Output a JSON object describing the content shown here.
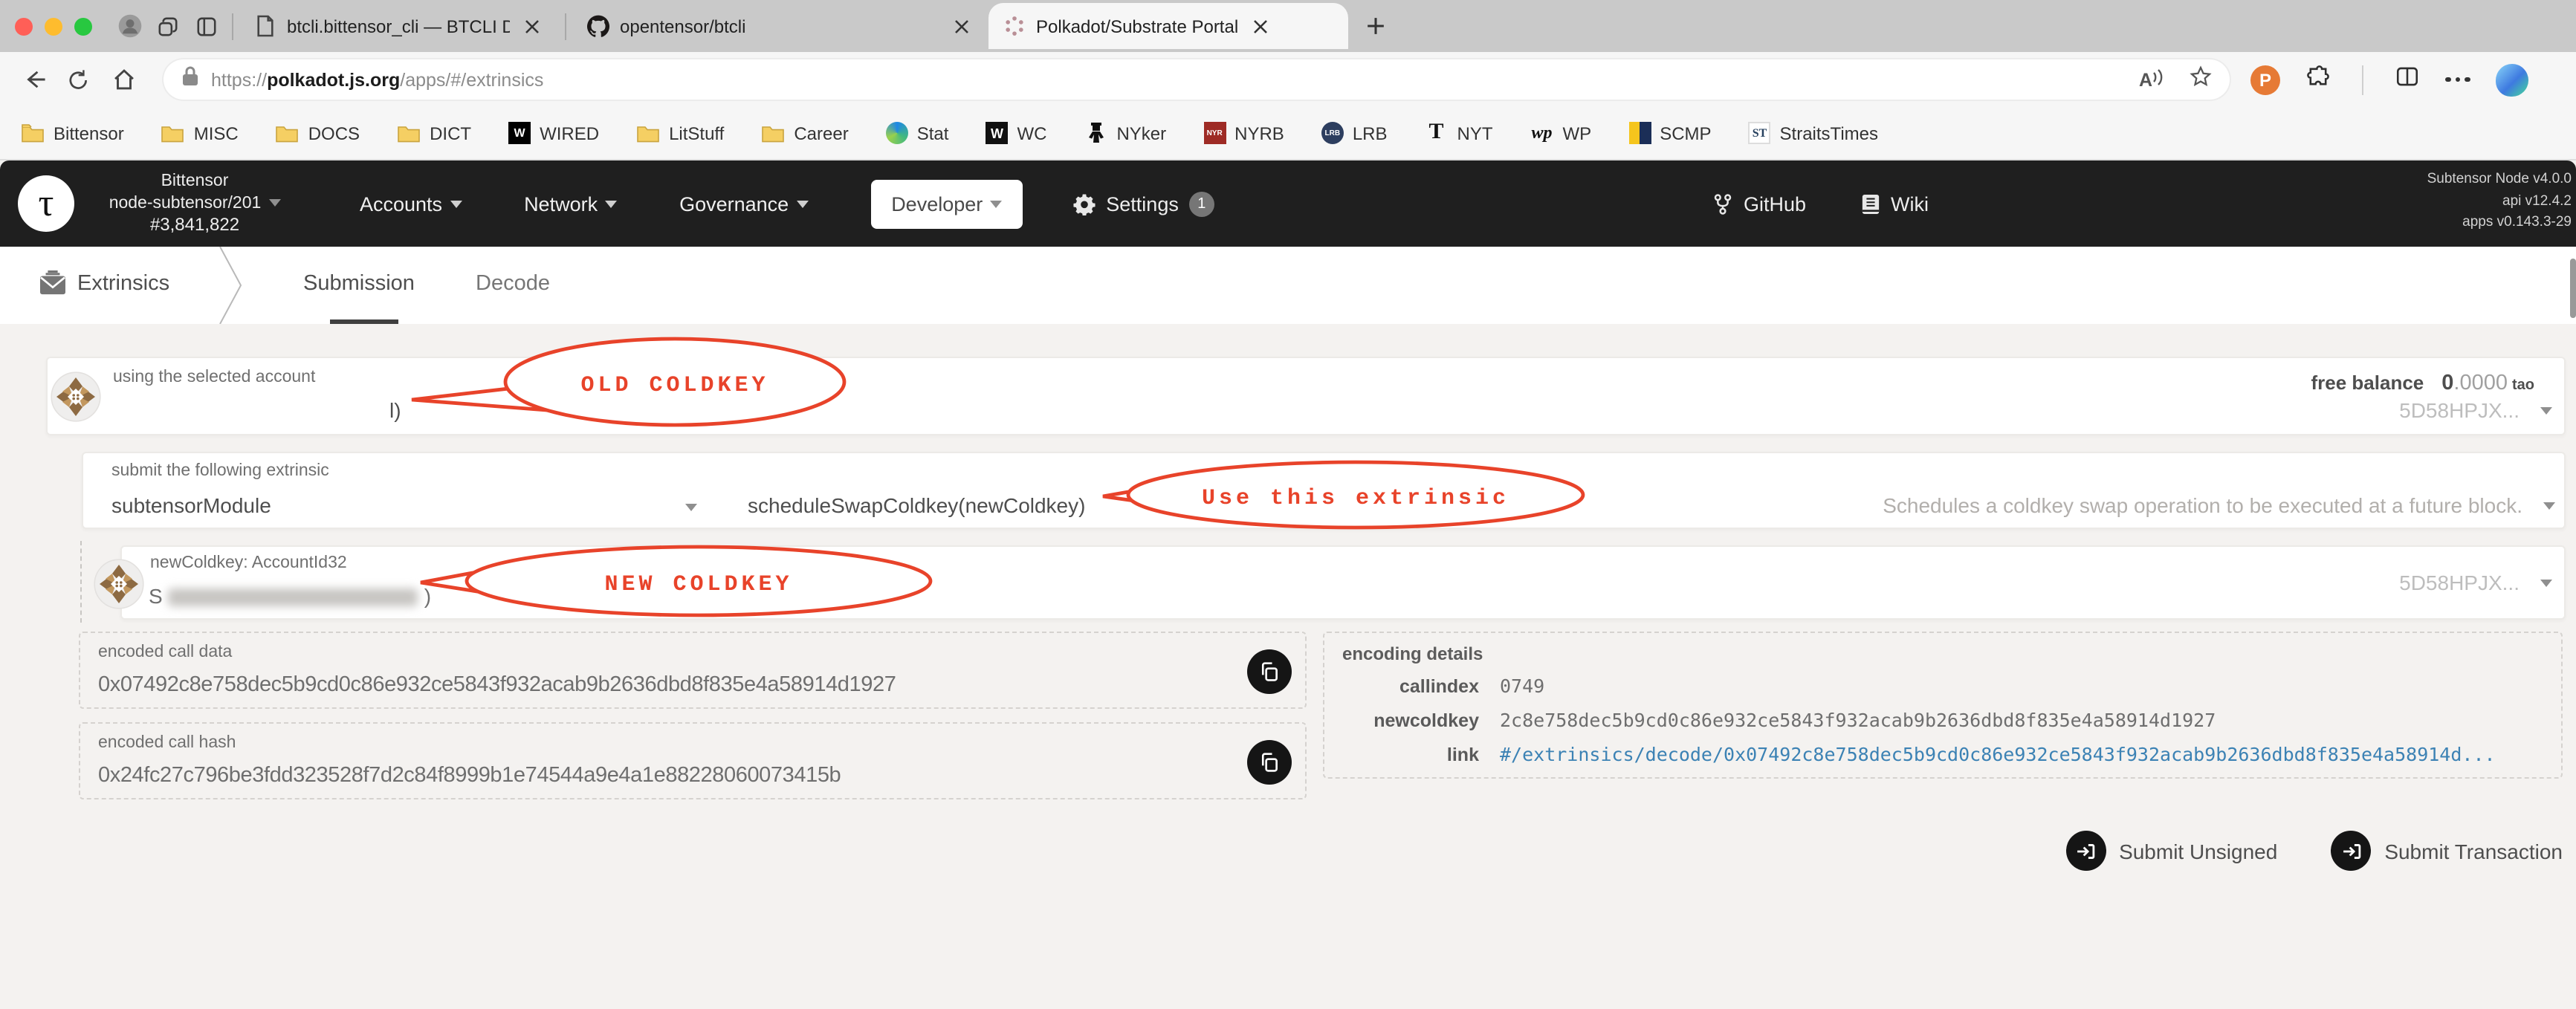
{
  "icons": {
    "tau": "τ",
    "polkadot_ext": "P",
    "read_aloud": "A",
    "wired": "W",
    "wc": "W",
    "nyrb": "NYR",
    "lrb": "LRB",
    "nyt": "T",
    "wp": "wp",
    "st": "ST"
  },
  "browser": {
    "tabs": [
      {
        "title": "btcli.bittensor_cli — BTCLI Docs"
      },
      {
        "title": "opentensor/btcli"
      },
      {
        "title": "Polkadot/Substrate Portal"
      }
    ],
    "url": {
      "scheme": "https://",
      "host": "polkadot.js.org",
      "path": "/apps/#/extrinsics"
    },
    "bookmarks": [
      {
        "label": "Bittensor"
      },
      {
        "label": "MISC"
      },
      {
        "label": "DOCS"
      },
      {
        "label": "DICT"
      },
      {
        "label": "WIRED"
      },
      {
        "label": "LitStuff"
      },
      {
        "label": "Career"
      },
      {
        "label": "Stat"
      },
      {
        "label": "WC"
      },
      {
        "label": "NYker"
      },
      {
        "label": "NYRB"
      },
      {
        "label": "LRB"
      },
      {
        "label": "NYT"
      },
      {
        "label": "WP"
      },
      {
        "label": "SCMP"
      },
      {
        "label": "StraitsTimes"
      }
    ]
  },
  "portal": {
    "chain": "Bittensor",
    "node": "node-subtensor/201",
    "block": "#3,841,822",
    "nav": {
      "accounts": "Accounts",
      "network": "Network",
      "governance": "Governance",
      "developer": "Developer",
      "settings": "Settings",
      "settings_badge": "1"
    },
    "links": {
      "github": "GitHub",
      "wiki": "Wiki"
    },
    "versions": {
      "node": "Subtensor Node v4.0.0",
      "api": "api v12.4.2",
      "apps": "apps v0.143.3-29"
    }
  },
  "subnav": {
    "section": "Extrinsics",
    "tab_submission": "Submission",
    "tab_decode": "Decode"
  },
  "account_row": {
    "label": "using the selected account",
    "name_fragment": "l)",
    "balance_label": "free balance",
    "balance_int": "0",
    "balance_frac": ".0000",
    "balance_unit": "tao",
    "address_short": "5D58HPJX..."
  },
  "extrinsic_row": {
    "label": "submit the following extrinsic",
    "module": "subtensorModule",
    "method": "scheduleSwapColdkey(newColdkey)",
    "description": "Schedules a coldkey swap operation to be executed at a future block."
  },
  "newcoldkey_row": {
    "label": "newColdkey: AccountId32",
    "value_start": "S",
    "value_end": ")",
    "address_short": "5D58HPJX..."
  },
  "encoded_call_data": {
    "label": "encoded call data",
    "value": "0x07492c8e758dec5b9cd0c86e932ce5843f932acab9b2636dbd8f835e4a58914d1927"
  },
  "encoded_call_hash": {
    "label": "encoded call hash",
    "value": "0x24fc27c796be3fdd323528f7d2c84f8999b1e74544a9e4a1e88228060073415b"
  },
  "encoding_details": {
    "heading": "encoding details",
    "rows": [
      {
        "label": "callindex",
        "value": "0749"
      },
      {
        "label": "newcoldkey",
        "value": "2c8e758dec5b9cd0c86e932ce5843f932acab9b2636dbd8f835e4a58914d1927"
      },
      {
        "label": "link",
        "value": "#/extrinsics/decode/0x07492c8e758dec5b9cd0c86e932ce5843f932acab9b2636dbd8f835e4a58914d..."
      }
    ]
  },
  "actions": {
    "submit_unsigned": "Submit Unsigned",
    "submit_transaction": "Submit Transaction"
  },
  "annotations": {
    "old_coldkey": "OLD COLDKEY",
    "use_extrinsic": "Use this extrinsic",
    "new_coldkey": "NEW COLDKEY",
    "color": "#e8432a"
  }
}
